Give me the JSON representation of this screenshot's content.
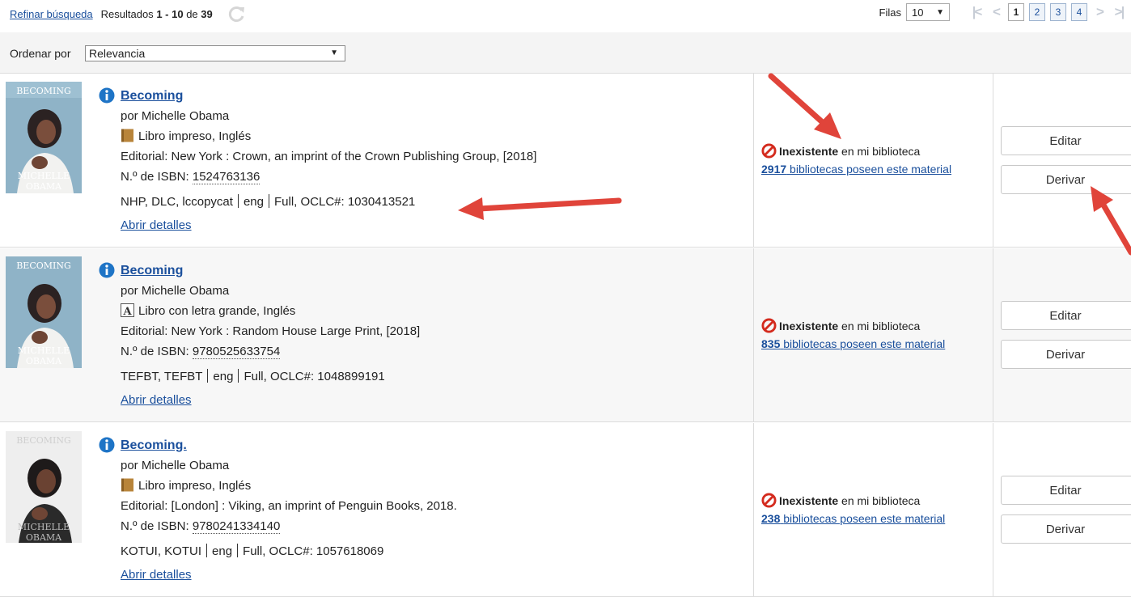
{
  "topbar": {
    "refine_link": "Refinar búsqueda",
    "results_prefix": "Resultados",
    "results_range": "1 - 10",
    "results_of": "de",
    "results_total": "39",
    "rows_label": "Filas",
    "rows_value": "10",
    "pages": [
      "1",
      "2",
      "3",
      "4"
    ]
  },
  "sort": {
    "label": "Ordenar por",
    "value": "Relevancia"
  },
  "results": [
    {
      "title": "Becoming",
      "author": "por Michelle Obama",
      "format": "Libro impreso, Inglés",
      "publisher": "Editorial: New York : Crown, an imprint of the Crown Publishing Group, [2018]",
      "isbn_label": "N.º de ISBN:",
      "isbn": "1524763136",
      "codes": "NHP, DLC, lccopycat",
      "lang": "eng",
      "level": "Full, OCLC#: 1030413521",
      "open_details": "Abrir detalles",
      "holding_status": "Inexistente",
      "holding_suffix": "en mi biblioteca",
      "library_count": "2917",
      "library_text": "bibliotecas poseen este material",
      "edit_label": "Editar",
      "derive_label": "Derivar"
    },
    {
      "title": "Becoming",
      "author": "por Michelle Obama",
      "format": "Libro con letra grande, Inglés",
      "publisher": "Editorial: New York : Random House Large Print, [2018]",
      "isbn_label": "N.º de ISBN:",
      "isbn": "9780525633754",
      "codes": "TEFBT, TEFBT",
      "lang": "eng",
      "level": "Full, OCLC#: 1048899191",
      "open_details": "Abrir detalles",
      "holding_status": "Inexistente",
      "holding_suffix": "en mi biblioteca",
      "library_count": "835",
      "library_text": "bibliotecas poseen este material",
      "edit_label": "Editar",
      "derive_label": "Derivar"
    },
    {
      "title": "Becoming.",
      "author": "por Michelle Obama",
      "format": "Libro impreso, Inglés",
      "publisher": "Editorial: [London] : Viking, an imprint of Penguin Books, 2018.",
      "isbn_label": "N.º de ISBN:",
      "isbn": "9780241334140",
      "codes": "KOTUI, KOTUI",
      "lang": "eng",
      "level": "Full, OCLC#: 1057618069",
      "open_details": "Abrir detalles",
      "holding_status": "Inexistente",
      "holding_suffix": "en mi biblioteca",
      "library_count": "238",
      "library_text": "bibliotecas poseen este material",
      "edit_label": "Editar",
      "derive_label": "Derivar"
    }
  ],
  "colors": {
    "link": "#1a4f9c",
    "annotation_arrow": "#e0443a",
    "no_holding_icon": "#d42b1e",
    "info_icon": "#1e74c6"
  }
}
